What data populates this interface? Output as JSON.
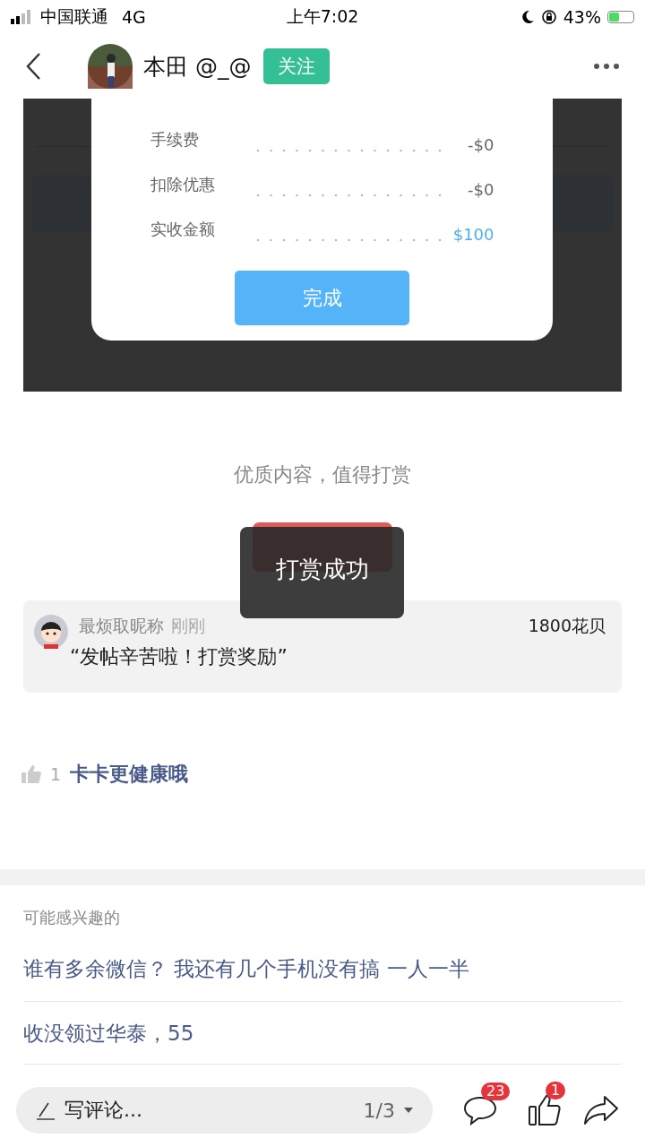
{
  "status_bar": {
    "carrier": "中国联通",
    "network": "4G",
    "time": "上午7:02",
    "battery": "43%"
  },
  "header": {
    "name": "本田 @_@",
    "follow": "关注"
  },
  "embedded_screenshot": {
    "dialog": {
      "rows": [
        {
          "label": "手续费",
          "value": "-$0",
          "kind": "normal"
        },
        {
          "label": "扣除优惠",
          "value": "-$0",
          "kind": "normal"
        },
        {
          "label": "实收金额",
          "value": "$100",
          "kind": "total"
        }
      ],
      "button": "完成"
    }
  },
  "reward": {
    "prompt": "优质内容，值得打赏",
    "toast": "打赏成功"
  },
  "reward_record": {
    "user": "最烦取昵称",
    "time": "刚刚",
    "amount": "1800花贝",
    "message": "“发帖辛苦啦！打赏奖励”"
  },
  "like": {
    "count": "1",
    "text": "卡卡更健康哦"
  },
  "related": {
    "title": "可能感兴趣的",
    "items": [
      "谁有多余微信？ 我还有几个手机没有搞 一人一半",
      "收没领过华泰，55"
    ]
  },
  "bottom_bar": {
    "placeholder": "写评论...",
    "page": "1/3",
    "comments_badge": "23",
    "likes_badge": "1"
  }
}
